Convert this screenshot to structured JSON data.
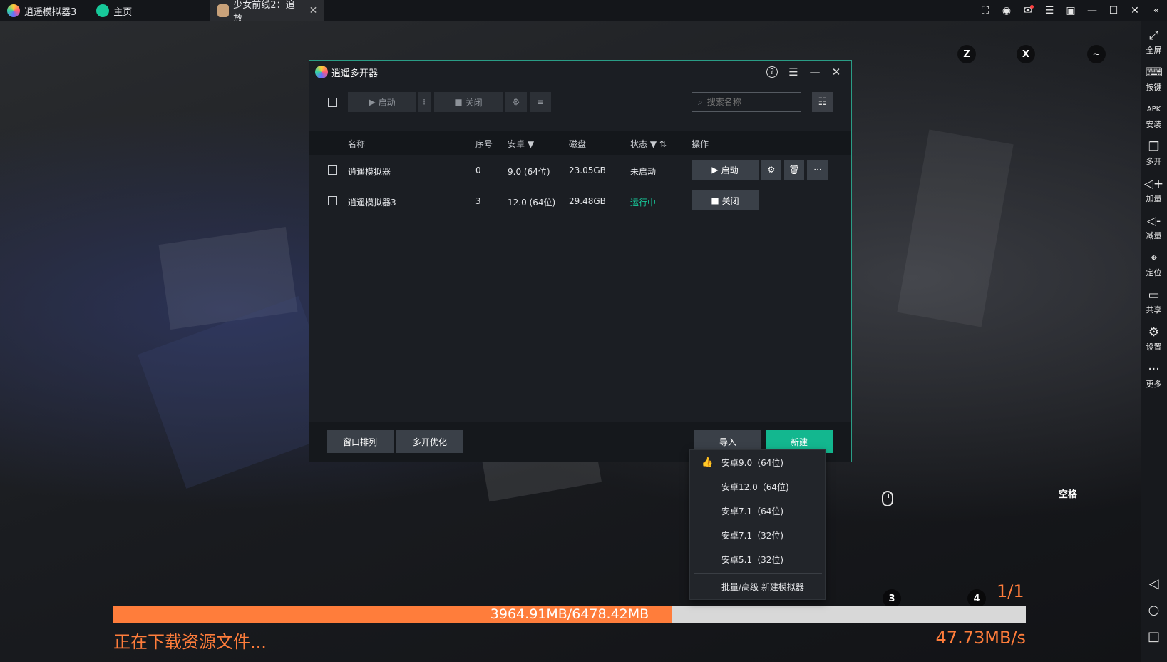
{
  "titlebar": {
    "tabs": [
      {
        "label": "逍遥模拟器3"
      },
      {
        "label": "主页"
      },
      {
        "label": "少女前线2：追放"
      }
    ]
  },
  "dialog": {
    "title": "逍遥多开器",
    "toolbar": {
      "start_label": "启动",
      "close_label": "关闭",
      "search_placeholder": "搜索名称"
    },
    "columns": {
      "name": "名称",
      "index": "序号",
      "android": "安卓",
      "disk": "磁盘",
      "status": "状态",
      "actions": "操作"
    },
    "rows": [
      {
        "name": "逍遥模拟器",
        "index": "0",
        "android": "9.0 (64位)",
        "disk": "23.05GB",
        "status": "未启动",
        "action": "启动"
      },
      {
        "name": "逍遥模拟器3",
        "index": "3",
        "android": "12.0 (64位)",
        "disk": "29.48GB",
        "status": "运行中",
        "action": "关闭"
      }
    ],
    "footer": {
      "arrange": "窗口排列",
      "optimize": "多开优化",
      "import": "导入",
      "new": "新建"
    }
  },
  "dropdown": {
    "items": [
      "安卓9.0（64位)",
      "安卓12.0（64位)",
      "安卓7.1（64位)",
      "安卓7.1（32位)",
      "安卓5.1（32位)"
    ],
    "batch": "批量/高级 新建模拟器"
  },
  "keys": {
    "z": "Z",
    "x": "X",
    "tilde": "~",
    "space": "空格",
    "k3": "3",
    "k4": "4"
  },
  "download": {
    "progress_text": "3964.91MB/6478.42MB",
    "progress_fraction": 0.612,
    "status": "正在下载资源文件...",
    "speed": "47.73MB/s",
    "page": "1/1"
  },
  "sidebar": {
    "items": [
      "全屏",
      "按键",
      "安装",
      "多开",
      "加量",
      "减量",
      "定位",
      "共享",
      "设置",
      "更多"
    ]
  },
  "colors": {
    "accent": "#13b78f",
    "progress": "#ff7d3b",
    "running": "#17c99a"
  }
}
